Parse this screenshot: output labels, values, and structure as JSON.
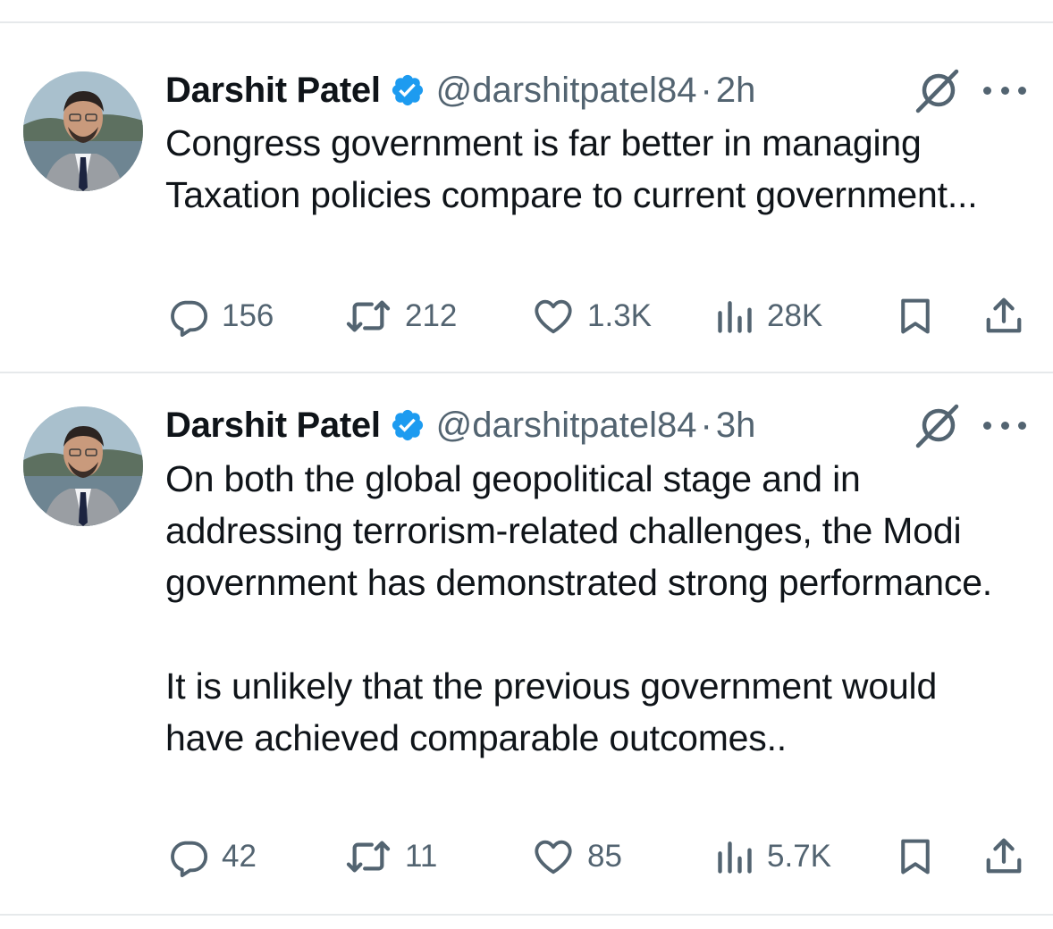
{
  "tweets": [
    {
      "author_name": "Darshit Patel",
      "handle": "@darshitpatel84",
      "separator": "·",
      "time": "2h",
      "paragraphs": [
        "Congress government is far better in managing Taxation policies compare to current government..."
      ],
      "replies": "156",
      "reposts": "212",
      "likes": "1.3K",
      "views": "28K"
    },
    {
      "author_name": "Darshit Patel",
      "handle": "@darshitpatel84",
      "separator": "·",
      "time": "3h",
      "paragraphs": [
        "On both the global geopolitical stage and in addressing terrorism-related challenges, the Modi government has demonstrated strong performance.",
        "It is unlikely that the previous government would have achieved comparable outcomes.."
      ],
      "replies": "42",
      "reposts": "11",
      "likes": "85",
      "views": "5.7K"
    }
  ],
  "icons": {
    "verified": "verified-badge-icon",
    "grok": "grok-icon",
    "more": "more-options-icon",
    "reply": "reply-icon",
    "repost": "repost-icon",
    "like": "like-icon",
    "views": "views-icon",
    "bookmark": "bookmark-icon",
    "share": "share-icon"
  },
  "colors": {
    "text": "#0f1419",
    "secondary": "#536471",
    "verified": "#1d9bf0",
    "divider": "#e6e9eb"
  }
}
